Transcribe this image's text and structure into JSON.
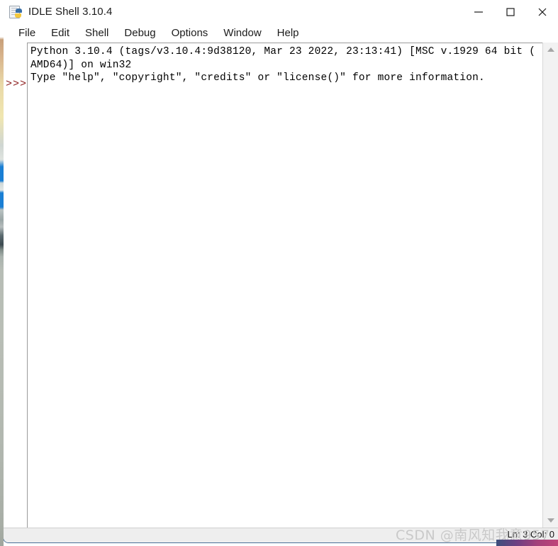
{
  "window": {
    "title": "IDLE Shell 3.10.4",
    "icon": "python-file-icon",
    "controls": {
      "minimize": "minimize-icon",
      "maximize": "maximize-icon",
      "close": "close-icon"
    }
  },
  "menubar": {
    "items": [
      {
        "label": "File"
      },
      {
        "label": "Edit"
      },
      {
        "label": "Shell"
      },
      {
        "label": "Debug"
      },
      {
        "label": "Options"
      },
      {
        "label": "Window"
      },
      {
        "label": "Help"
      }
    ]
  },
  "shell": {
    "prompt": ">>>",
    "prompt_color": "#8b1a1a",
    "output_lines": [
      "Python 3.10.4 (tags/v3.10.4:9d38120, Mar 23 2022, 23:13:41) [MSC v.1929 64 bit (",
      "AMD64)] on win32",
      "Type \"help\", \"copyright\", \"credits\" or \"license()\" for more information."
    ],
    "output_text": "Python 3.10.4 (tags/v3.10.4:9d38120, Mar 23 2022, 23:13:41) [MSC v.1929 64 bit (\nAMD64)] on win32\nType \"help\", \"copyright\", \"credits\" or \"license()\" for more information."
  },
  "scrollbar": {
    "up_arrow": "scroll-up-icon",
    "down_arrow": "scroll-down-icon"
  },
  "statusbar": {
    "position": "Ln: 3  Col: 0"
  },
  "watermark": {
    "text": "CSDN @南风知我意957"
  }
}
